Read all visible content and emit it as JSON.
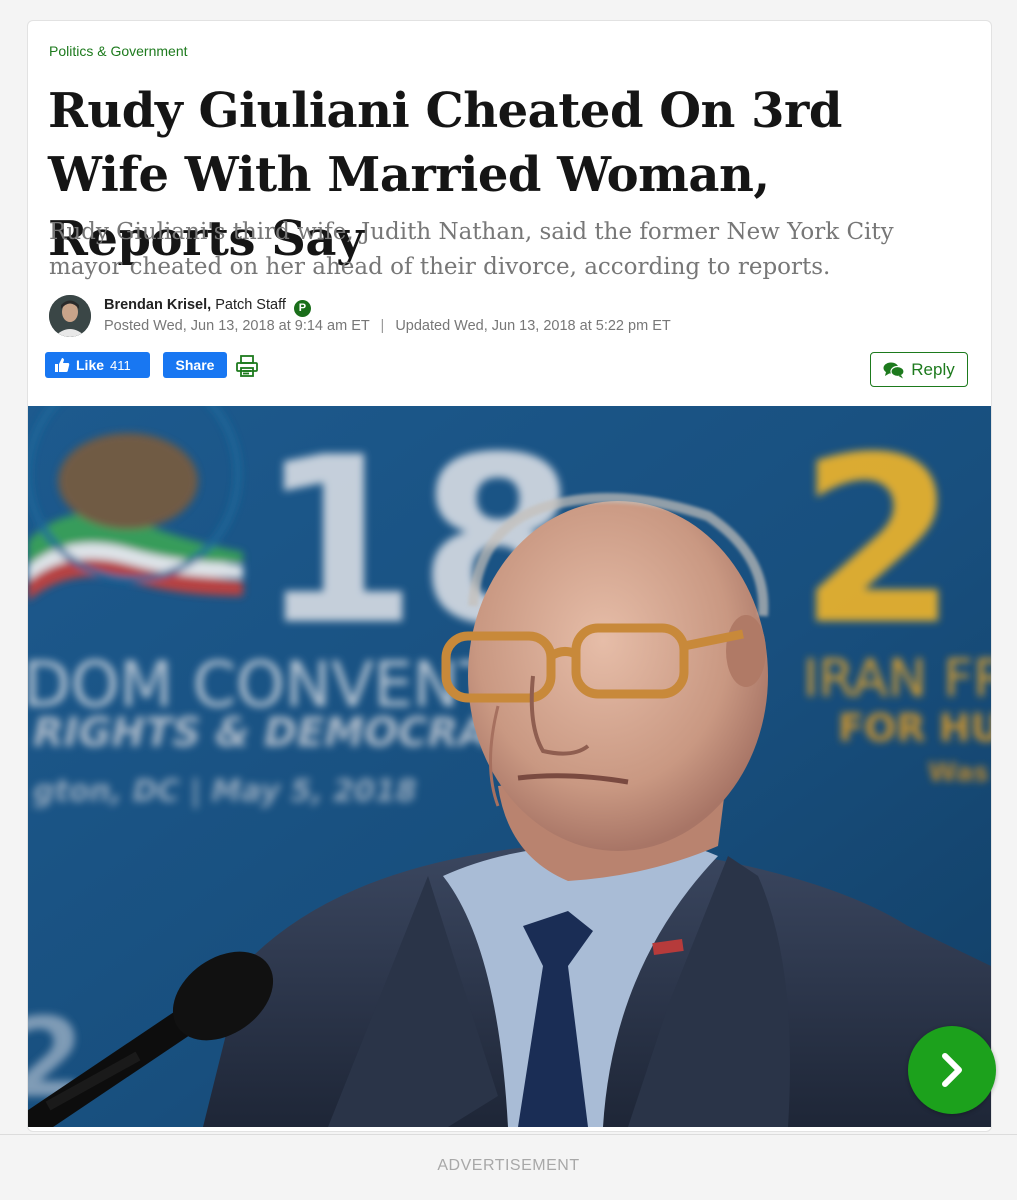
{
  "article": {
    "category": "Politics & Government",
    "headline": "Rudy Giuliani Cheated On 3rd Wife With Married Woman, Reports Say",
    "dek": "Rudy Giuliani's third wife, Judith Nathan, said the former New York City mayor cheated on her ahead of their divorce, according to reports."
  },
  "author": {
    "name": "Brendan Krisel,",
    "role": "Patch Staff",
    "badge": "P",
    "posted": "Posted Wed, Jun 13, 2018 at 9:14 am ET",
    "separator": "|",
    "updated": "Updated Wed, Jun 13, 2018 at 5:22 pm ET"
  },
  "actions": {
    "like_label": "Like",
    "like_count": "411",
    "share_label": "Share",
    "reply_label": "Reply",
    "print_icon": "printer-icon",
    "comment_icon": "comments-icon"
  },
  "photo": {
    "backdrop_numbers": [
      "18",
      "2"
    ],
    "backdrop_lines": [
      "DOM CONVENTI",
      "RIGHTS & DEMOCRAC",
      "gton, DC | May 5, 2018",
      "IRAN FRE",
      "FOR HUM",
      "Was"
    ]
  },
  "footer": {
    "ad_label": "ADVERTISEMENT",
    "next_icon": "chevron-right-icon"
  },
  "colors": {
    "brand_green": "#1d7a1d",
    "next_button": "#1ca11c",
    "facebook_blue": "#1877f2"
  }
}
